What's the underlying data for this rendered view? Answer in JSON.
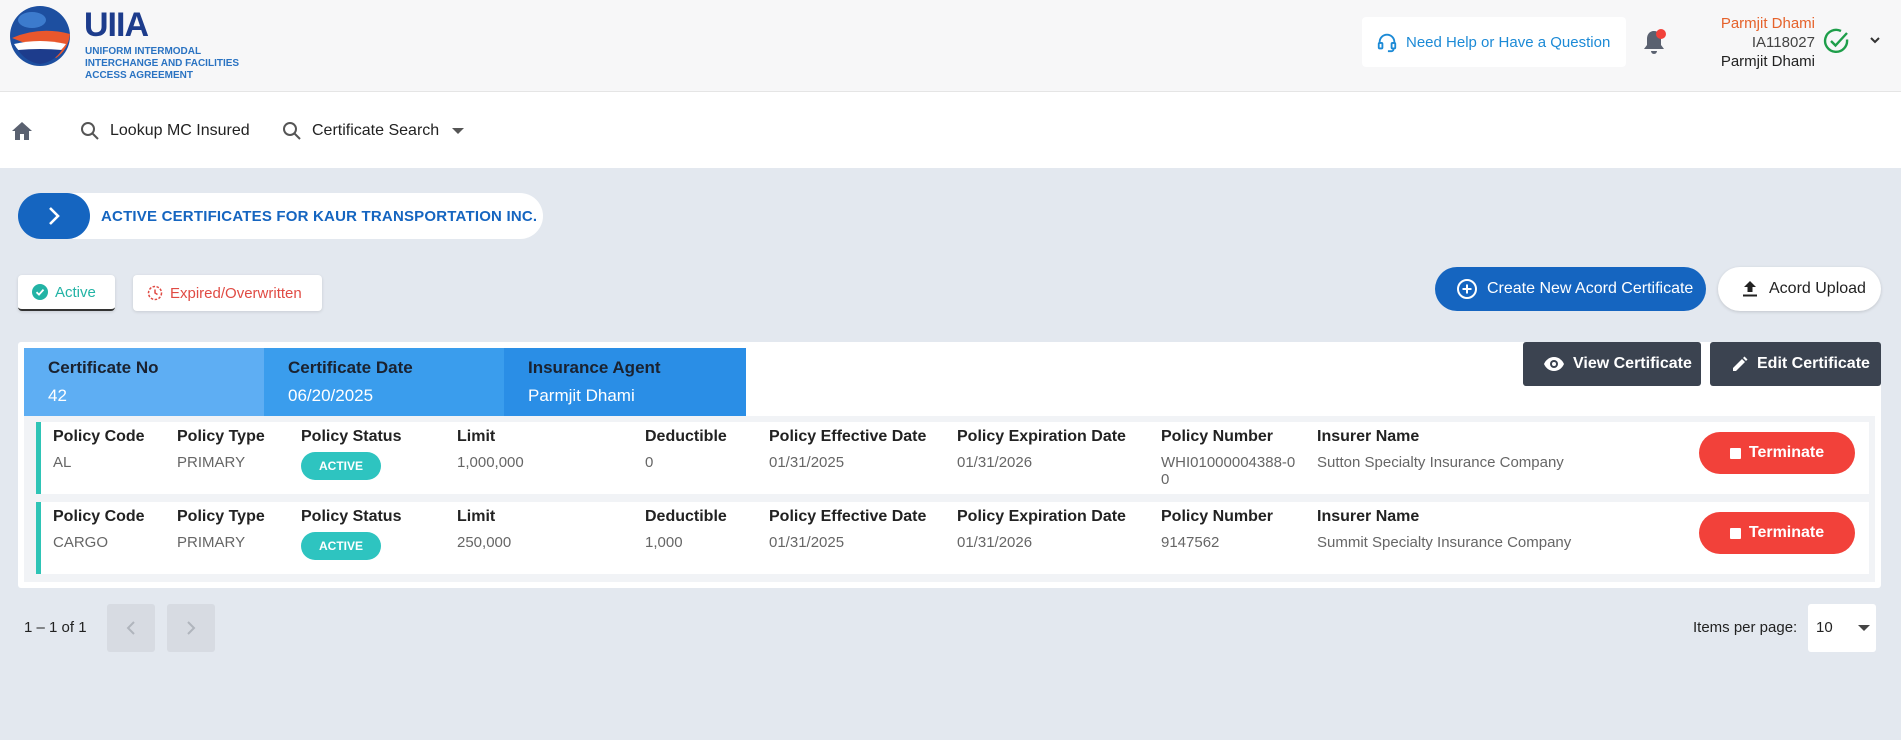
{
  "header": {
    "logo_title": "UIIA",
    "logo_subtitle_1": "UNIFORM INTERMODAL",
    "logo_subtitle_2": "INTERCHANGE AND FACILITIES",
    "logo_subtitle_3": "ACCESS AGREEMENT",
    "help_label": "Need Help or Have a Question",
    "user_name_top": "Parmjit Dhami",
    "user_id": "IA118027",
    "user_name": "Parmjit Dhami"
  },
  "nav": {
    "lookup_label": "Lookup MC Insured",
    "cert_search_label": "Certificate Search"
  },
  "page_title": "ACTIVE CERTIFICATES FOR KAUR TRANSPORTATION INC.",
  "filters": {
    "active_label": "Active",
    "expired_label": "Expired/Overwritten"
  },
  "actions": {
    "create_label": "Create New Acord Certificate",
    "upload_label": "Acord Upload",
    "view_label": "View Certificate",
    "edit_label": "Edit Certificate"
  },
  "certificate": {
    "no_label": "Certificate No",
    "no_value": "42",
    "date_label": "Certificate Date",
    "date_value": "06/20/2025",
    "agent_label": "Insurance Agent",
    "agent_value": "Parmjit Dhami"
  },
  "policy_labels": {
    "code": "Policy Code",
    "type": "Policy Type",
    "status": "Policy Status",
    "limit": "Limit",
    "deductible": "Deductible",
    "effective": "Policy Effective Date",
    "expiration": "Policy Expiration Date",
    "number": "Policy Number",
    "insurer": "Insurer Name",
    "terminate": "Terminate"
  },
  "policies": [
    {
      "code": "AL",
      "type": "PRIMARY",
      "status": "ACTIVE",
      "limit": "1,000,000",
      "deductible": "0",
      "effective": "01/31/2025",
      "expiration": "01/31/2026",
      "number_line1": "WHI01000004388-0",
      "number_line2": "0",
      "insurer": "Sutton Specialty Insurance Company"
    },
    {
      "code": "CARGO",
      "type": "PRIMARY",
      "status": "ACTIVE",
      "limit": "250,000",
      "deductible": "1,000",
      "effective": "01/31/2025",
      "expiration": "01/31/2026",
      "number_line1": "9147562",
      "number_line2": "",
      "insurer": "Summit Specialty Insurance Company"
    }
  ],
  "pagination": {
    "range": "1 – 1 of 1",
    "items_per_page_label": "Items per page:",
    "items_per_page_value": "10"
  },
  "colors": {
    "primary": "#1565c0",
    "teal": "#2ec4b6",
    "danger": "#f2413a",
    "dark_button": "#3b4350",
    "orange_user": "#e5622b"
  }
}
